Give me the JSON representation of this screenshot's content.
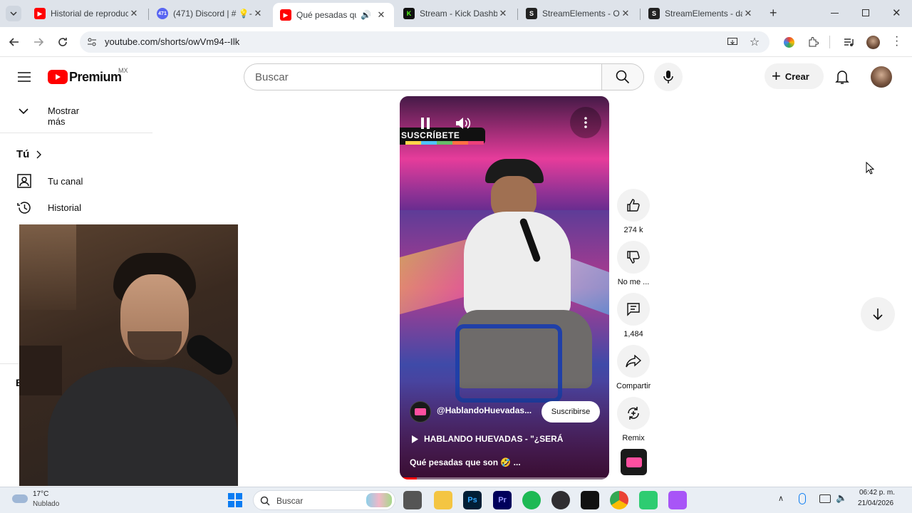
{
  "browser": {
    "tabs": [
      {
        "title": "Historial de reproducción",
        "favicon": "youtube-icon",
        "active": false
      },
      {
        "title": "(471) Discord | # 💡-i",
        "favicon": "discord-icon",
        "badge": "471",
        "active": false
      },
      {
        "title": "Qué pesadas que son",
        "favicon": "youtube-icon",
        "active": true,
        "audio": true
      },
      {
        "title": "Stream - Kick Dashboard",
        "favicon": "kick-icon",
        "active": false
      },
      {
        "title": "StreamElements - Overlay",
        "favicon": "streamelements-icon",
        "active": false
      },
      {
        "title": "StreamElements - dashboard",
        "favicon": "streamelements-icon",
        "active": false
      }
    ],
    "new_tab": "+",
    "url": "youtube.com/shorts/owVm94--Ilk"
  },
  "youtube": {
    "logo_text": "Premium",
    "logo_region": "MX",
    "search_placeholder": "Buscar",
    "create_label": "Crear",
    "sidebar": {
      "show_more": "Mostrar más",
      "you_label": "Tú",
      "your_channel": "Tu canal",
      "history": "Historial",
      "partial_letter": "E"
    },
    "short": {
      "overlay_banner": "SUSCRÍBETE",
      "channel": "@HablandoHuevadas...",
      "subscribe": "Suscribirse",
      "playlist": "HABLANDO HUEVADAS - \"¿SERÁ",
      "caption": "Qué pesadas que son 🤣 ..."
    },
    "actions": {
      "likes": "274 k",
      "dislike": "No me ...",
      "comments": "1,484",
      "share": "Compartir",
      "remix": "Remix"
    }
  },
  "taskbar": {
    "weather_temp": "17°C",
    "weather_desc": "Nublado",
    "search_label": "Buscar",
    "time": "06:42 p. m.",
    "date": "21/04/2026"
  },
  "colors": {
    "youtube_red": "#ff0000",
    "tabstrip_bg": "#dee3ea",
    "taskbar_bg": "#e9eef4"
  }
}
